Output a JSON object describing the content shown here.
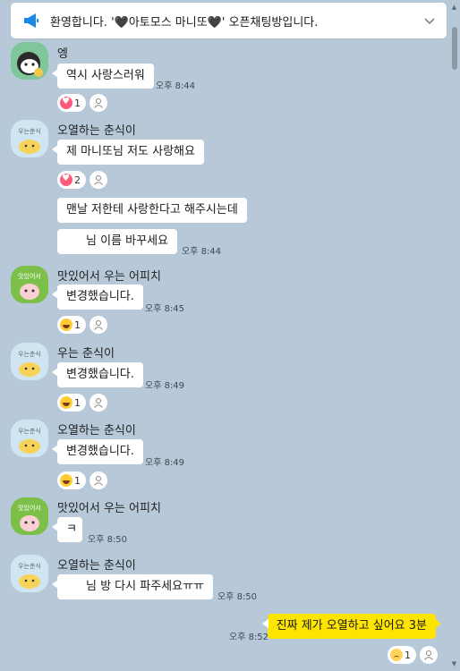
{
  "notice": {
    "text": "환영합니다. '🖤아토모스 마니또🖤' 오픈채팅방입니다.",
    "icon": "megaphone-icon",
    "accent": "#1e88e5"
  },
  "colors": {
    "background": "#b7c9d8",
    "my_bubble": "#fee500",
    "bubble": "#ffffff"
  },
  "messages": [
    {
      "sender": "엥",
      "avatar_label": "",
      "text": "역시 사랑스러워",
      "time": "오후 8:44",
      "reaction": {
        "emoji": "heart",
        "count": "1"
      }
    },
    {
      "sender": "오열하는 춘식이",
      "avatar_label": "우는춘식",
      "text": "제 마니또님 저도 사랑해요",
      "time": "",
      "reaction": {
        "emoji": "heart",
        "count": "2"
      }
    },
    {
      "sender": "",
      "text": "맨날 저한테 사랑한다고 해주시는데",
      "time": ""
    },
    {
      "sender": "",
      "text": "님 이름 바꾸세요",
      "time": "오후 8:44"
    },
    {
      "sender": "맛있어서 우는 어피치",
      "avatar_label": "맛있어서",
      "text": "변경했습니다.",
      "time": "오후 8:45",
      "reaction": {
        "emoji": "laugh",
        "count": "1"
      }
    },
    {
      "sender": "우는 춘식이",
      "avatar_label": "우는춘식",
      "text": "변경했습니다.",
      "time": "오후 8:49",
      "reaction": {
        "emoji": "laugh",
        "count": "1"
      }
    },
    {
      "sender": "오열하는 춘식이",
      "avatar_label": "우는춘식",
      "text": "변경했습니다.",
      "time": "오후 8:49",
      "reaction": {
        "emoji": "laugh",
        "count": "1"
      }
    },
    {
      "sender": "맛있어서 우는 어피치",
      "avatar_label": "맛있어서",
      "text": "ㅋ",
      "time": "오후 8:50"
    },
    {
      "sender": "오열하는 춘식이",
      "avatar_label": "우는춘식",
      "text": "님 방 다시 파주세요ㅠㅠ",
      "time": "오후 8:50"
    }
  ],
  "my_message": {
    "text": "진짜 제가 오열하고 싶어요 3분",
    "time": "오후 8:52",
    "reaction": {
      "emoji": "sad",
      "count": "1"
    }
  }
}
